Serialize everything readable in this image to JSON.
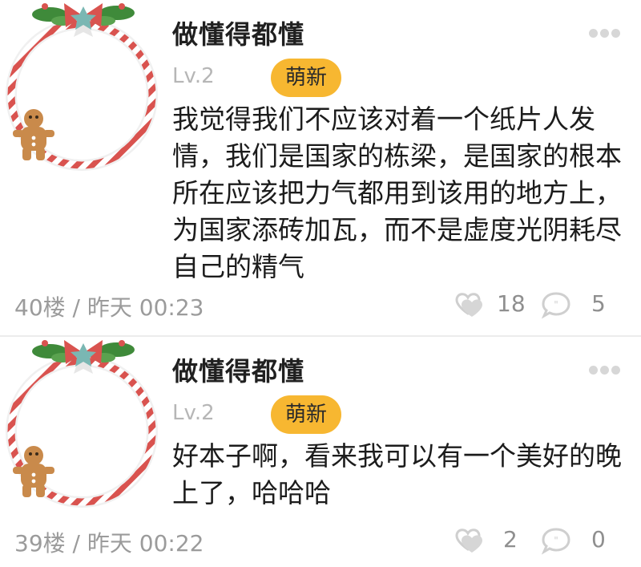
{
  "posts": [
    {
      "username": "做懂得都懂",
      "level": "Lv.2",
      "badge": "萌新",
      "content": "我觉得我们不应该对着一个纸片人发情，我们是国家的栋梁，是国家的根本所在应该把力气都用到该用的地方上，为国家添砖加瓦，而不是虚度光阴耗尽自己的精气",
      "floor_time": "40楼 / 昨天 00:23",
      "likes": "18",
      "comments": "5"
    },
    {
      "username": "做懂得都懂",
      "level": "Lv.2",
      "badge": "萌新",
      "content": "好本子啊，看来我可以有一个美好的晚上了，哈哈哈",
      "floor_time": "39楼 / 昨天 00:22",
      "likes": "2",
      "comments": "0"
    }
  ],
  "colors": {
    "badge_bg": "#f7b731",
    "wreath_red": "#d9534f",
    "meta_gray": "#9b9b9b"
  },
  "icons": {
    "avatar": "christmas-wreath-gingerbread",
    "more": "more-dots-icon",
    "like": "heart-like-icon",
    "comment": "comment-bubble-icon"
  }
}
